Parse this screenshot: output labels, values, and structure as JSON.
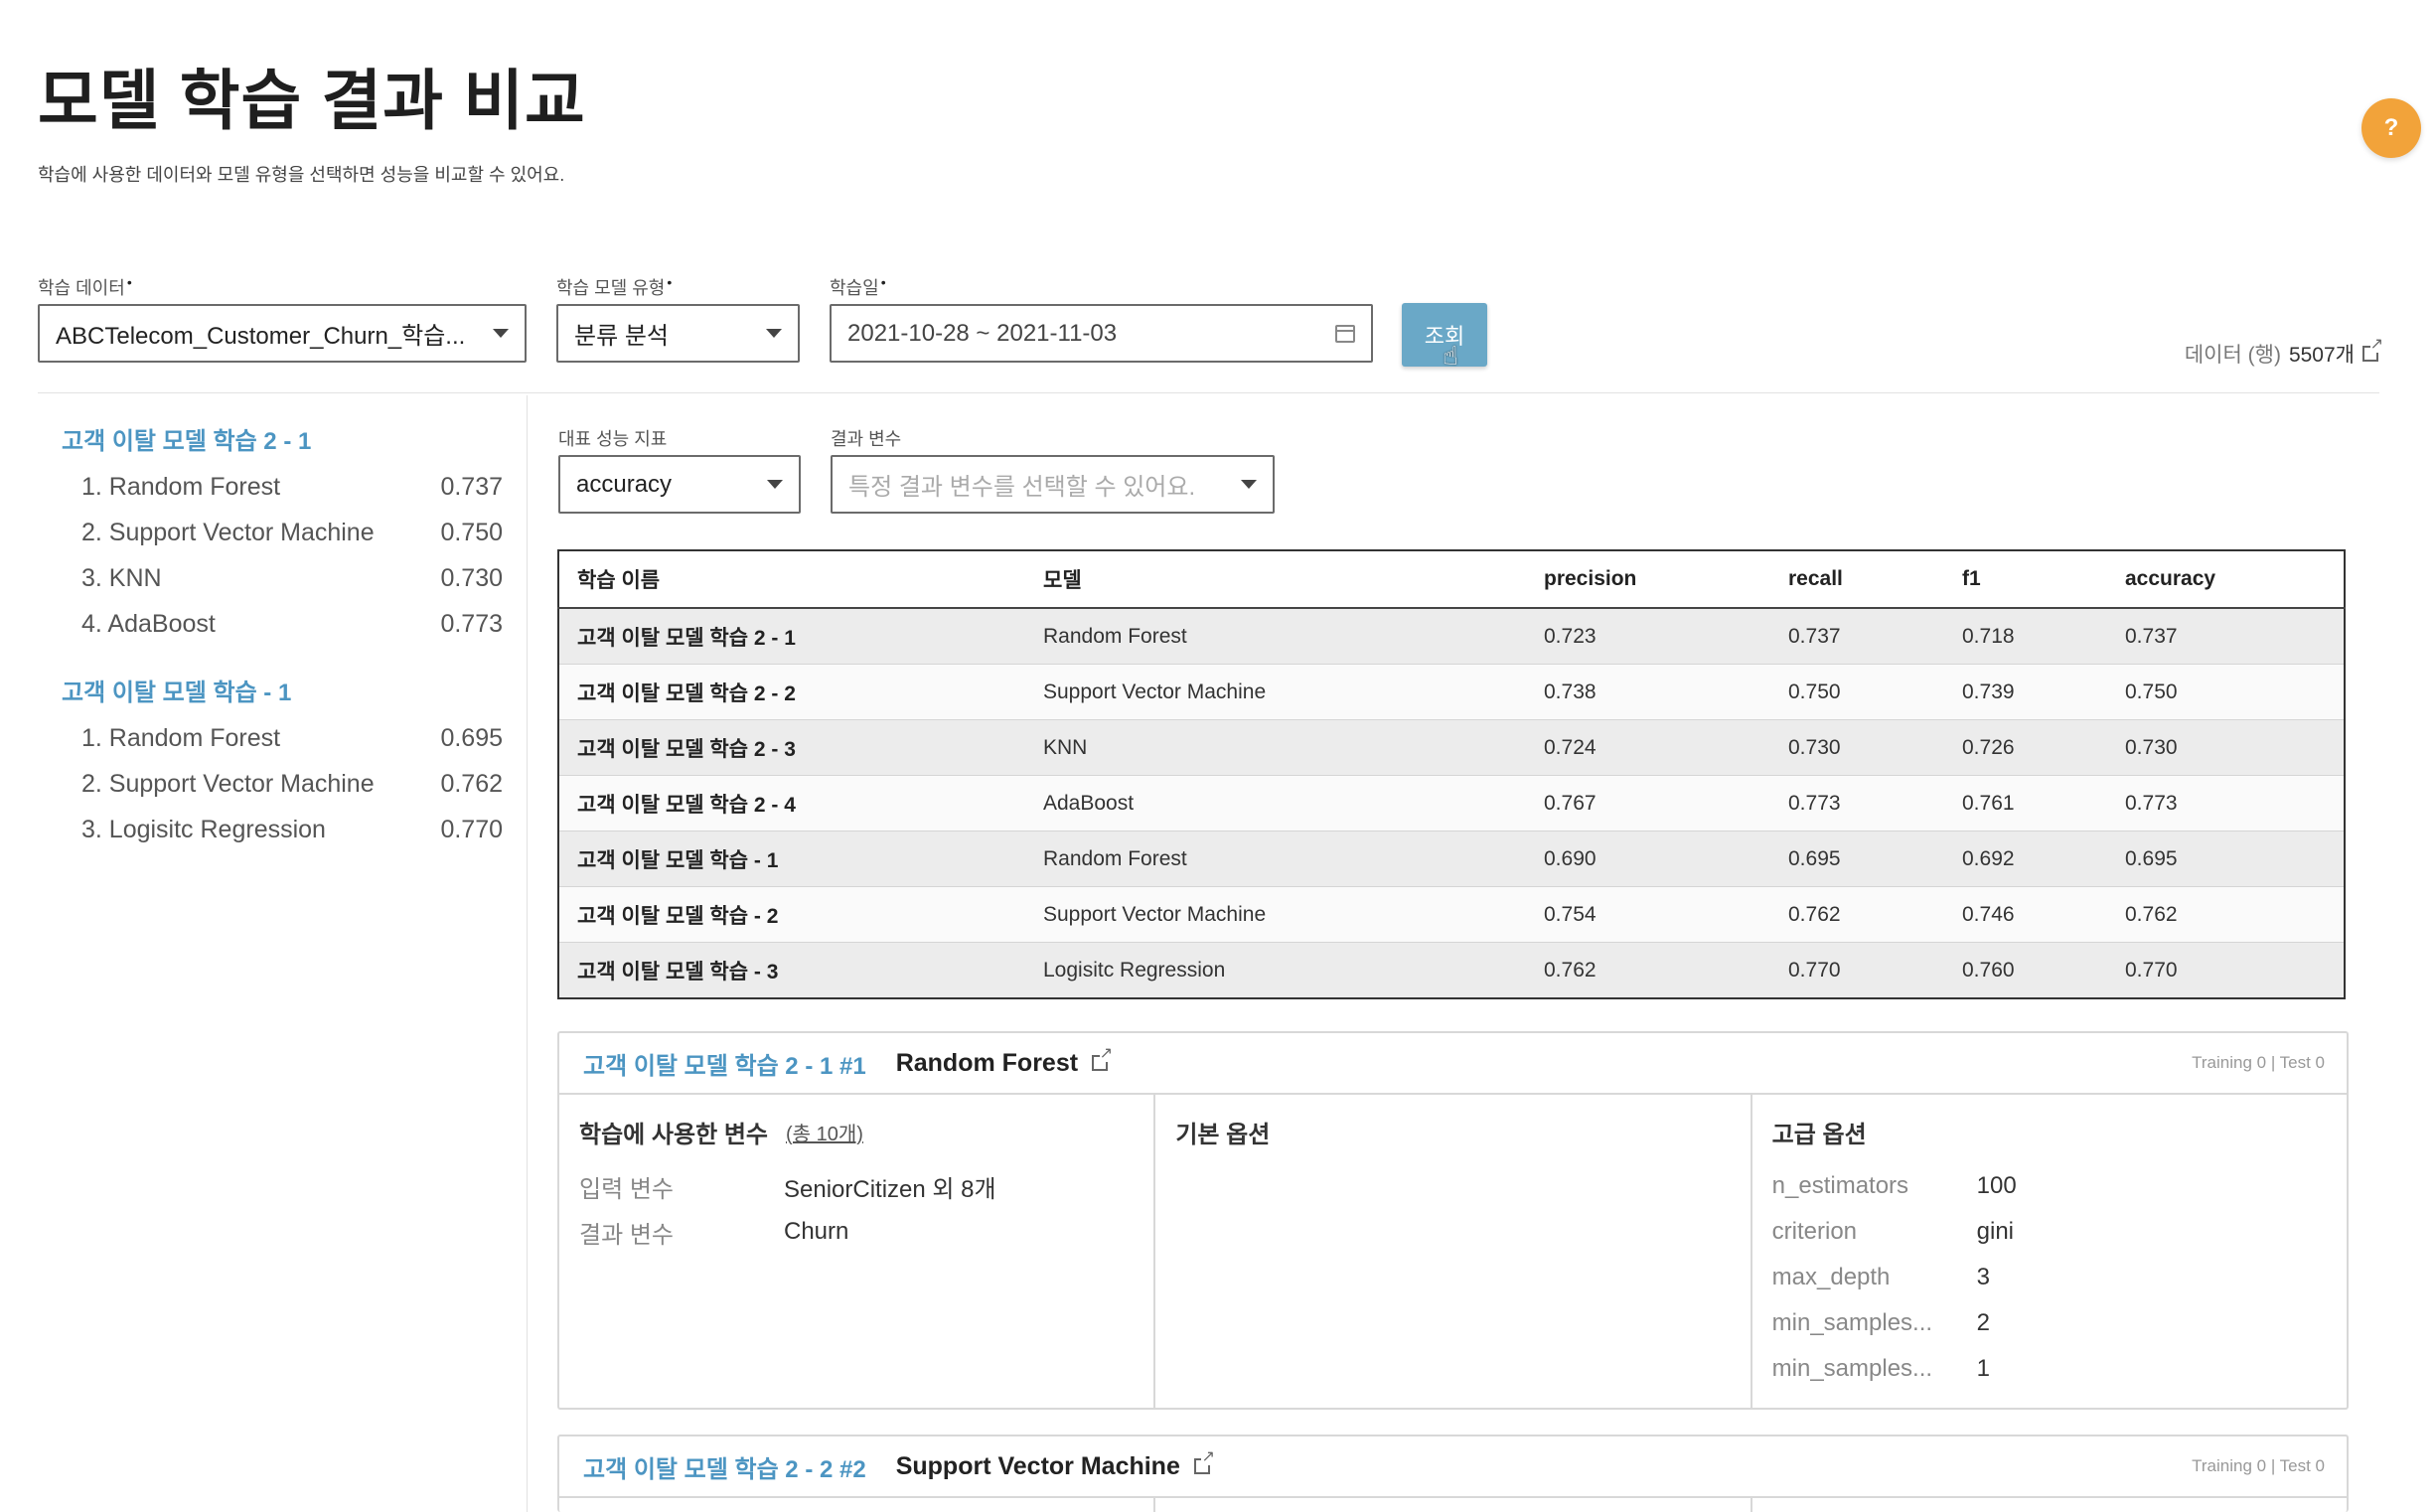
{
  "page": {
    "title": "모델 학습 결과 비교",
    "description": "학습에 사용한 데이터와 모델 유형을 선택하면 성능을 비교할 수 있어요."
  },
  "help_label": "?",
  "filters": {
    "data_label": "학습 데이터",
    "data_value": "ABCTelecom_Customer_Churn_학습...",
    "model_type_label": "학습 모델 유형",
    "model_type_value": "분류 분석",
    "date_label": "학습일",
    "date_value": "2021-10-28 ~ 2021-11-03",
    "query_button": "조회",
    "required_mark": "•",
    "data_count_label": "데이터 (행)",
    "data_count_value": "5507개"
  },
  "sidebar": {
    "groups": [
      {
        "title": "고객 이탈 모델 학습 2 - 1",
        "models": [
          {
            "name": "1. Random Forest",
            "score": "0.737"
          },
          {
            "name": "2. Support Vector Machine",
            "score": "0.750"
          },
          {
            "name": "3. KNN",
            "score": "0.730"
          },
          {
            "name": "4. AdaBoost",
            "score": "0.773"
          }
        ]
      },
      {
        "title": "고객 이탈 모델 학습 - 1",
        "models": [
          {
            "name": "1. Random Forest",
            "score": "0.695"
          },
          {
            "name": "2. Support Vector Machine",
            "score": "0.762"
          },
          {
            "name": "3. Logisitc Regression",
            "score": "0.770"
          }
        ]
      }
    ]
  },
  "metric_filter": {
    "metric_label": "대표 성능 지표",
    "metric_value": "accuracy",
    "result_var_label": "결과 변수",
    "result_var_placeholder": "특정 결과 변수를 선택할 수 있어요."
  },
  "table": {
    "headers": [
      "학습 이름",
      "모델",
      "precision",
      "recall",
      "f1",
      "accuracy"
    ],
    "rows": [
      [
        "고객 이탈 모델 학습 2 - 1",
        "Random Forest",
        "0.723",
        "0.737",
        "0.718",
        "0.737"
      ],
      [
        "고객 이탈 모델 학습 2 - 2",
        "Support Vector Machine",
        "0.738",
        "0.750",
        "0.739",
        "0.750"
      ],
      [
        "고객 이탈 모델 학습 2 - 3",
        "KNN",
        "0.724",
        "0.730",
        "0.726",
        "0.730"
      ],
      [
        "고객 이탈 모델 학습 2 - 4",
        "AdaBoost",
        "0.767",
        "0.773",
        "0.761",
        "0.773"
      ],
      [
        "고객 이탈 모델 학습 - 1",
        "Random Forest",
        "0.690",
        "0.695",
        "0.692",
        "0.695"
      ],
      [
        "고객 이탈 모델 학습 - 2",
        "Support Vector Machine",
        "0.754",
        "0.762",
        "0.746",
        "0.762"
      ],
      [
        "고객 이탈 모델 학습 - 3",
        "Logisitc Regression",
        "0.762",
        "0.770",
        "0.760",
        "0.770"
      ]
    ]
  },
  "cards": [
    {
      "link": "고객 이탈 모델 학습 2 - 1 #1",
      "model": "Random Forest",
      "training_test": "Training 0 | Test 0",
      "vars_title": "학습에 사용한 변수",
      "vars_total": "(총 10개)",
      "input_label": "입력 변수",
      "input_value": "SeniorCitizen 외 8개",
      "output_label": "결과 변수",
      "output_value": "Churn",
      "basic_title": "기본 옵션",
      "advanced_title": "고급 옵션",
      "advanced": [
        {
          "k": "n_estimators",
          "v": "100"
        },
        {
          "k": "criterion",
          "v": "gini"
        },
        {
          "k": "max_depth",
          "v": "3"
        },
        {
          "k": "min_samples...",
          "v": "2"
        },
        {
          "k": "min_samples...",
          "v": "1"
        }
      ]
    },
    {
      "link": "고객 이탈 모델 학습 2 - 2 #2",
      "model": "Support Vector Machine",
      "training_test": "Training 0 | Test 0"
    }
  ]
}
